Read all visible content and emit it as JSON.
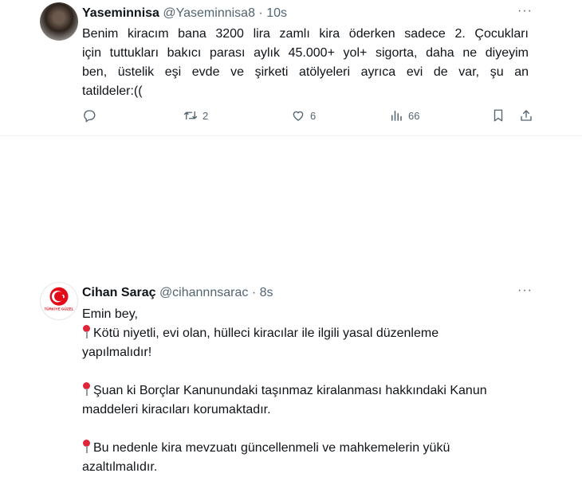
{
  "tweets": [
    {
      "name": "Yaseminnisa",
      "handle": "@Yaseminnisa8",
      "separator": "·",
      "time": "10s",
      "text_lines": [
        "Benim kiracım bana 3200 lira zamlı kira öderken sadece 2. Çocukları",
        "için tuttukları bakıcı parası aylık 45.000+ yol+ sigorta, daha ne diyeyim",
        "ben, üstelik eşi evde ve şirketi atölyeleri ayrıca evi de var, şu an",
        "tatildeler:(("
      ],
      "stats": {
        "retweets": "2",
        "likes": "6",
        "views": "66"
      }
    },
    {
      "name": "Cihan Saraç",
      "handle": "@cihannnsarac",
      "separator": "·",
      "time": "8s",
      "avatar_text": "TÜRKİYE GÜZEL",
      "greeting": "Emin bey,",
      "points": [
        {
          "line1": "Kötü niyetli, evi olan, hülleci kiracılar ile ilgili yasal düzenleme",
          "line2": "yapılmalıdır!"
        },
        {
          "line1": "Şuan ki Borçlar Kanunundaki taşınmaz kiralanması hakkındaki Kanun",
          "line2": "maddeleri kiracıları korumaktadır."
        },
        {
          "line1": "Bu nedenle kira mevzuatı güncellenmeli ve mahkemelerin yükü",
          "line2": "azaltılmalıdır."
        }
      ]
    }
  ],
  "more_symbol": "···",
  "colors": {
    "text": "#0f1419",
    "secondary": "#536471",
    "divider": "#eff3f4",
    "pin": "#e0243a"
  }
}
